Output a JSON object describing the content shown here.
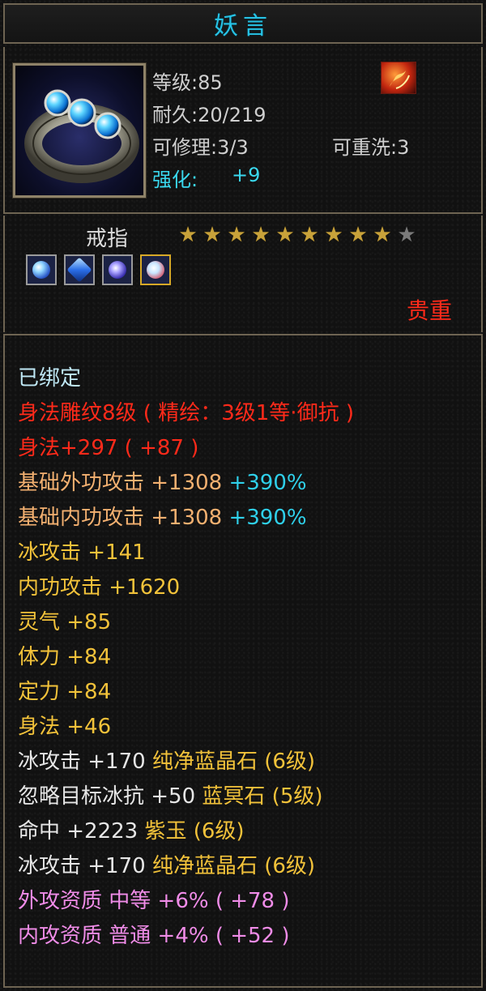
{
  "item": {
    "name": "妖言",
    "level": "等级:85",
    "durability": "耐久:20/219",
    "repair": "可修理:3/3",
    "rewash": "可重洗:3",
    "strengthen_label": "强化:",
    "strengthen_value": "+9",
    "type": "戒指",
    "stars_filled": 9,
    "stars_total": 10,
    "rarity": "贵重",
    "gem_slots": [
      "blue-gem-icon",
      "blue-crystal-icon",
      "violet-gem-icon",
      "gold-framed-gem-icon"
    ]
  },
  "properties": {
    "bound": "已绑定",
    "engrave": "身法雕纹8级 ( 精绘：3级1等·御抗 )",
    "agility_engrave": "身法+297 ( +87 )",
    "base_outer_attack": {
      "label": "基础外功攻击 +1308",
      "bonus": "+390%"
    },
    "base_inner_attack": {
      "label": "基础内功攻击 +1308",
      "bonus": "+390%"
    },
    "ice_attack": "冰攻击 +141",
    "inner_attack": "内功攻击 +1620",
    "spirit": "灵气 +85",
    "stamina": "体力 +84",
    "focus": "定力 +84",
    "agility": "身法 +46",
    "gem1": {
      "stat": "冰攻击 +170",
      "gem": "纯净蓝晶石 (6级)"
    },
    "gem2": {
      "stat": "忽略目标冰抗 +50",
      "gem": "蓝冥石 (5级)"
    },
    "gem3": {
      "stat": "命中 +2223",
      "gem": "紫玉 (6级)"
    },
    "gem4": {
      "stat": "冰攻击 +170",
      "gem": "纯净蓝晶石 (6级)"
    },
    "outer_quality": "外攻资质  中等 +6% ( +78 )",
    "inner_quality": "内攻资质  普通 +4% ( +52 )"
  },
  "colors": {
    "title": "#27c3e6",
    "rarity": "#ff2a1a",
    "engrave": "#ff2a1a",
    "base_stat": "#f3b070",
    "stat": "#f2c23a",
    "bonus": "#2fd0ea",
    "quality": "#f08ce8"
  }
}
